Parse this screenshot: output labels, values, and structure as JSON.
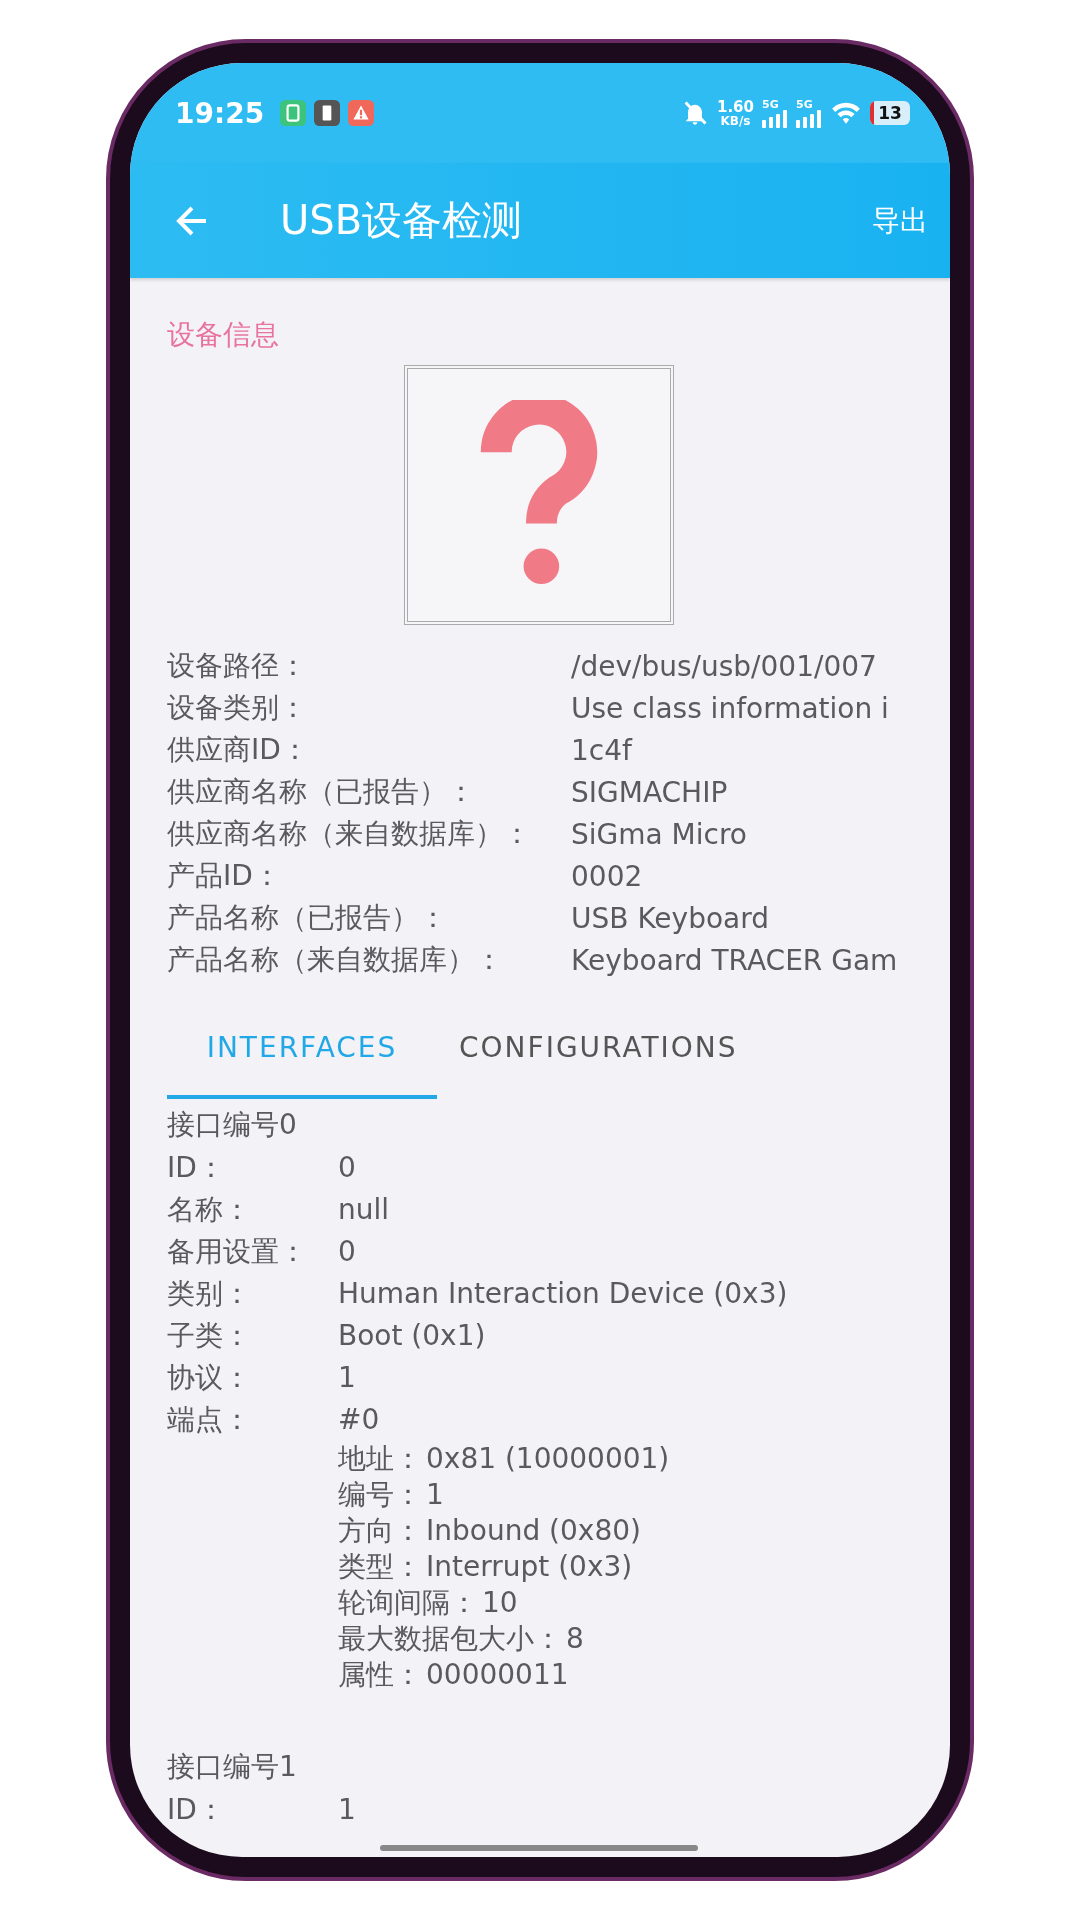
{
  "status_bar": {
    "time": "19:25",
    "net_speed": "1.60",
    "net_speed_unit": "KB/s",
    "signal_labels": [
      "5G",
      "5G"
    ],
    "battery": "13"
  },
  "app_bar": {
    "title": "USB设备检测",
    "action": "导出"
  },
  "device_info": {
    "heading": "设备信息",
    "fields": [
      {
        "label": "设备路径：",
        "value": "/dev/bus/usb/001/007"
      },
      {
        "label": "设备类别：",
        "value": "Use class information i"
      },
      {
        "label": "供应商ID：",
        "value": "1c4f"
      },
      {
        "label": "供应商名称（已报告）：",
        "value": "SIGMACHIP"
      },
      {
        "label": "供应商名称（来自数据库）：",
        "value": "SiGma Micro"
      },
      {
        "label": "产品ID：",
        "value": "0002"
      },
      {
        "label": "产品名称（已报告）：",
        "value": "USB Keyboard"
      },
      {
        "label": "产品名称（来自数据库）：",
        "value": "Keyboard TRACER Gam"
      }
    ]
  },
  "tabs": [
    {
      "label": "INTERFACES",
      "selected": true
    },
    {
      "label": "CONFIGURATIONS",
      "selected": false
    }
  ],
  "interfaces": [
    {
      "title": "接口编号0",
      "fields": [
        {
          "label": "ID：",
          "value": "0"
        },
        {
          "label": "名称：",
          "value": "null"
        },
        {
          "label": "备用设置：",
          "value": "0"
        },
        {
          "label": "类别：",
          "value": "Human Interaction Device (0x3)"
        },
        {
          "label": "子类：",
          "value": "Boot (0x1)"
        },
        {
          "label": "协议：",
          "value": "1"
        }
      ],
      "endpoints_label": "端点：",
      "endpoints": [
        {
          "title": "#0",
          "fields": [
            {
              "label": "地址：",
              "value": "0x81 (10000001)"
            },
            {
              "label": "编号：",
              "value": "1"
            },
            {
              "label": "方向：",
              "value": "Inbound (0x80)"
            },
            {
              "label": "类型：",
              "value": "Interrupt (0x3)"
            },
            {
              "label": "轮询间隔：",
              "value": "10"
            },
            {
              "label": "最大数据包大小：",
              "value": "8"
            },
            {
              "label": "属性：",
              "value": "00000011"
            }
          ]
        }
      ]
    },
    {
      "title": "接口编号1",
      "fields": [
        {
          "label": "ID：",
          "value": "1"
        }
      ]
    }
  ]
}
